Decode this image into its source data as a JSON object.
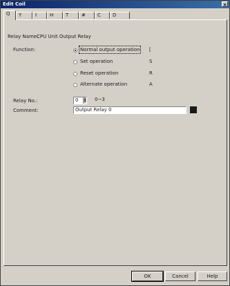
{
  "window": {
    "title": "Edit Coil",
    "close_glyph": "×"
  },
  "tabs": [
    "Q",
    "Y",
    "I",
    "H",
    "T",
    "#",
    "C",
    "D"
  ],
  "relay_name": {
    "label": "Relay Name:",
    "value": "CPU Unit Output Relay"
  },
  "function": {
    "label": "Function:",
    "options": [
      {
        "label": "Normal output operation",
        "symbol": "[",
        "checked": true
      },
      {
        "label": "Set operation",
        "symbol": "S",
        "checked": false
      },
      {
        "label": "Reset operation",
        "symbol": "R",
        "checked": false
      },
      {
        "label": "Alternate operation",
        "symbol": "A",
        "checked": false
      }
    ]
  },
  "relay_no": {
    "label": "Relay No.:",
    "value": "0",
    "range": "0~3"
  },
  "comment": {
    "label": "Comment:",
    "value": "Output Relay 0",
    "swatch_color": "#1a1a1a"
  },
  "buttons": {
    "ok": "OK",
    "cancel": "Cancel",
    "help": "Help"
  }
}
